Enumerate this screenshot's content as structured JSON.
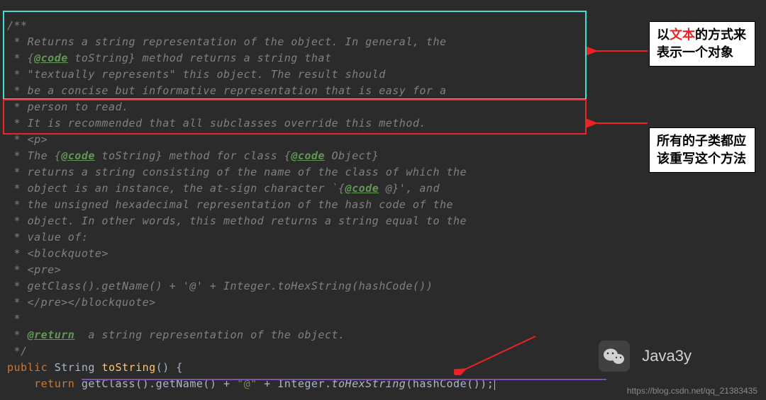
{
  "code": {
    "l1": "/**",
    "l2_prefix": " * Returns a string representation of the object. In general, the",
    "l3_a": " * {",
    "l3_tag": "@code",
    "l3_b": " toString} method returns a string that",
    "l4": " * \"textually represents\" this object. The result should",
    "l5": " * be a concise but informative representation that is easy for a",
    "l6": " * person to read.",
    "l7": " * It is recommended that all subclasses override this method.",
    "l8": " * <p>",
    "l9_a": " * The {",
    "l9_tag1": "@code",
    "l9_b": " toString} method for class {",
    "l9_tag2": "@code",
    "l9_c": " Object}",
    "l10": " * returns a string consisting of the name of the class of which the",
    "l11_a": " * object is an instance, the at-sign character `{",
    "l11_tag": "@code",
    "l11_b": " @}', and",
    "l12": " * the unsigned hexadecimal representation of the hash code of the",
    "l13": " * object. In other words, this method returns a string equal to the",
    "l14": " * value of:",
    "l15": " * <blockquote>",
    "l16": " * <pre>",
    "l17": " * getClass().getName() + '@' + Integer.toHexString(hashCode())",
    "l18": " * </pre></blockquote>",
    "l19": " *",
    "l20_a": " * ",
    "l20_tag": "@return",
    "l20_b": "  a string representation of the object.",
    "l21": " */",
    "sig_public": "public ",
    "sig_type": "String ",
    "sig_method": "toString",
    "sig_paren": "() {",
    "ret_kw": "    return ",
    "ret_p1": "getClass().getName() ",
    "ret_plus1": "+ ",
    "ret_str": "\"@\"",
    "ret_plus2": " + ",
    "ret_int": "Integer.",
    "ret_hex": "toHexString",
    "ret_p2": "(hashCode());"
  },
  "annotations": {
    "a1_pre": "以",
    "a1_red": "文本",
    "a1_post": "的方式来表示一个对象",
    "a2": "所有的子类都应该重写这个方法"
  },
  "watermark": {
    "brand": "Java3y",
    "url": "https://blog.csdn.net/qq_21383435"
  }
}
